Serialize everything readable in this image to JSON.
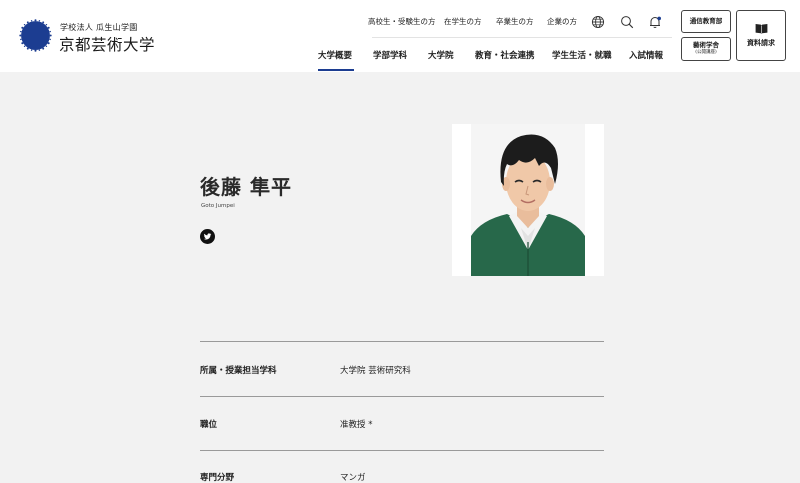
{
  "brand": {
    "subtitle": "学校法人 瓜生山学園",
    "name": "京都芸術大学",
    "logo_color": "#1c3d91"
  },
  "utility_nav": [
    "高校生・受験生の方",
    "在学生の方",
    "卒業生の方",
    "企業の方"
  ],
  "utility_icons": [
    "globe-icon",
    "search-icon",
    "bell-icon"
  ],
  "main_nav": [
    "大学概要",
    "学部学科",
    "大学院",
    "教育・社会連携",
    "学生生活・就職",
    "入試情報"
  ],
  "active_nav": "大学概要",
  "buttons": {
    "correspondence": "通信教育部",
    "arts_society_line1": "藝術学舎",
    "arts_society_line2": "(公開講座)",
    "request_docs": "資料請求"
  },
  "profile": {
    "name": "後藤 隼平",
    "name_roman": "Goto Jumpei",
    "social_icon": "twitter-icon"
  },
  "info_rows": [
    {
      "key": "所属・授業担当学科",
      "value": "大学院 芸術研究科"
    },
    {
      "key": "職位",
      "value": "准教授 *"
    },
    {
      "key": "専門分野",
      "value": "マンガ"
    }
  ],
  "colors": {
    "accent": "#1c3d91",
    "page_bg": "#f2f2f2",
    "header_bg": "#ffffff"
  }
}
